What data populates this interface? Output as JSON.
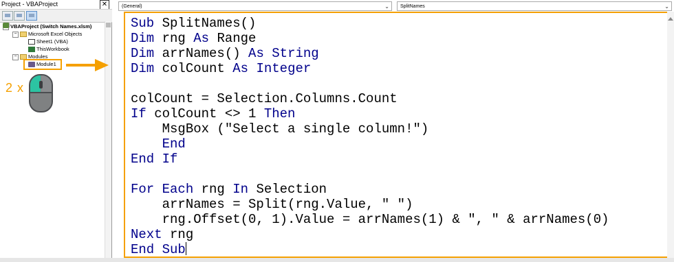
{
  "project_pane": {
    "title": "Project - VBAProject",
    "close_glyph": "✕",
    "tree": {
      "root": "VBAProject (Switch Names.xlsm)",
      "excel_objects": "Microsoft Excel Objects",
      "sheet1": "Sheet1 (VBA)",
      "thisworkbook": "ThisWorkbook",
      "modules": "Modules",
      "module1": "Module1"
    },
    "toggle_minus": "−"
  },
  "annotation": {
    "double_click_label": "2 x",
    "accent_color": "#f5a000",
    "mouse_button_color": "#2cc3a2"
  },
  "code_window": {
    "object_dropdown": "(General)",
    "procedure_dropdown": "SplitNames",
    "chevron": "⌄",
    "code_lines": [
      [
        {
          "t": "Sub",
          "k": 1
        },
        {
          "t": " SplitNames()"
        }
      ],
      [
        {
          "t": "Dim",
          "k": 1
        },
        {
          "t": " rng "
        },
        {
          "t": "As",
          "k": 1
        },
        {
          "t": " Range"
        }
      ],
      [
        {
          "t": "Dim",
          "k": 1
        },
        {
          "t": " arrNames() "
        },
        {
          "t": "As",
          "k": 1
        },
        {
          "t": " "
        },
        {
          "t": "String",
          "k": 1
        }
      ],
      [
        {
          "t": "Dim",
          "k": 1
        },
        {
          "t": " colCount "
        },
        {
          "t": "As",
          "k": 1
        },
        {
          "t": " "
        },
        {
          "t": "Integer",
          "k": 1
        }
      ],
      [],
      [
        {
          "t": "colCount = Selection.Columns.Count"
        }
      ],
      [
        {
          "t": "If",
          "k": 1
        },
        {
          "t": " colCount <> 1 "
        },
        {
          "t": "Then",
          "k": 1
        }
      ],
      [
        {
          "t": "    MsgBox (\"Select a single column!\")"
        }
      ],
      [
        {
          "t": "    "
        },
        {
          "t": "End",
          "k": 1
        }
      ],
      [
        {
          "t": "End If",
          "k": 1
        }
      ],
      [],
      [
        {
          "t": "For Each",
          "k": 1
        },
        {
          "t": " rng "
        },
        {
          "t": "In",
          "k": 1
        },
        {
          "t": " Selection"
        }
      ],
      [
        {
          "t": "    arrNames = Split(rng.Value, \" \")"
        }
      ],
      [
        {
          "t": "    rng.Offset(0, 1).Value = arrNames(1) & \", \" & arrNames(0)"
        }
      ],
      [
        {
          "t": "Next",
          "k": 1
        },
        {
          "t": " rng"
        }
      ],
      [
        {
          "t": "End Sub",
          "k": 1
        }
      ]
    ],
    "keyword_color": "#00008b"
  }
}
